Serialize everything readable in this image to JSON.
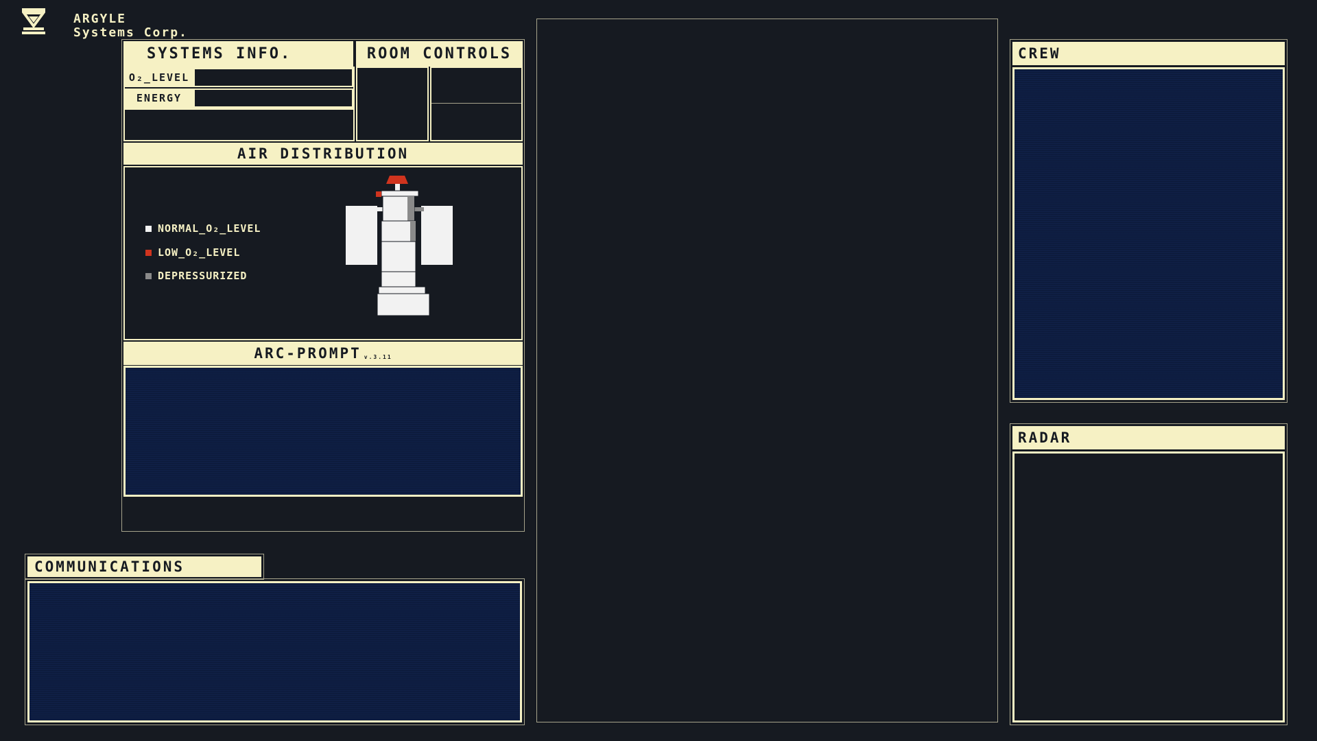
{
  "brand": {
    "logo_icon": "argyle-logo-icon",
    "line1": "ARGYLE",
    "line2": "Systems Corp."
  },
  "systems_info": {
    "title": "SYSTEMS INFO.",
    "o2_label": "O₂_LEVEL",
    "energy_label": "ENERGY"
  },
  "room_controls": {
    "title": "ROOM CONTROLS"
  },
  "air_distribution": {
    "title": "AIR DISTRIBUTION",
    "legend": [
      {
        "label": "NORMAL_O₂_LEVEL",
        "color": "#f2f2f2"
      },
      {
        "label": "LOW_O₂_LEVEL",
        "color": "#d0341e"
      },
      {
        "label": "DEPRESSURIZED",
        "color": "#8a8a8a"
      }
    ]
  },
  "arc_prompt": {
    "title": "ARC-PROMPT",
    "version": "v.3.11"
  },
  "communications": {
    "title": "COMMUNICATIONS"
  },
  "crew": {
    "title": "CREW"
  },
  "radar": {
    "title": "RADAR"
  },
  "colors": {
    "background": "#161a21",
    "accent": "#f6f1c4",
    "panel_navy": "#0f1f45",
    "low_o2": "#d0341e",
    "depressurized": "#8a8a8a",
    "normal": "#f2f2f2"
  }
}
